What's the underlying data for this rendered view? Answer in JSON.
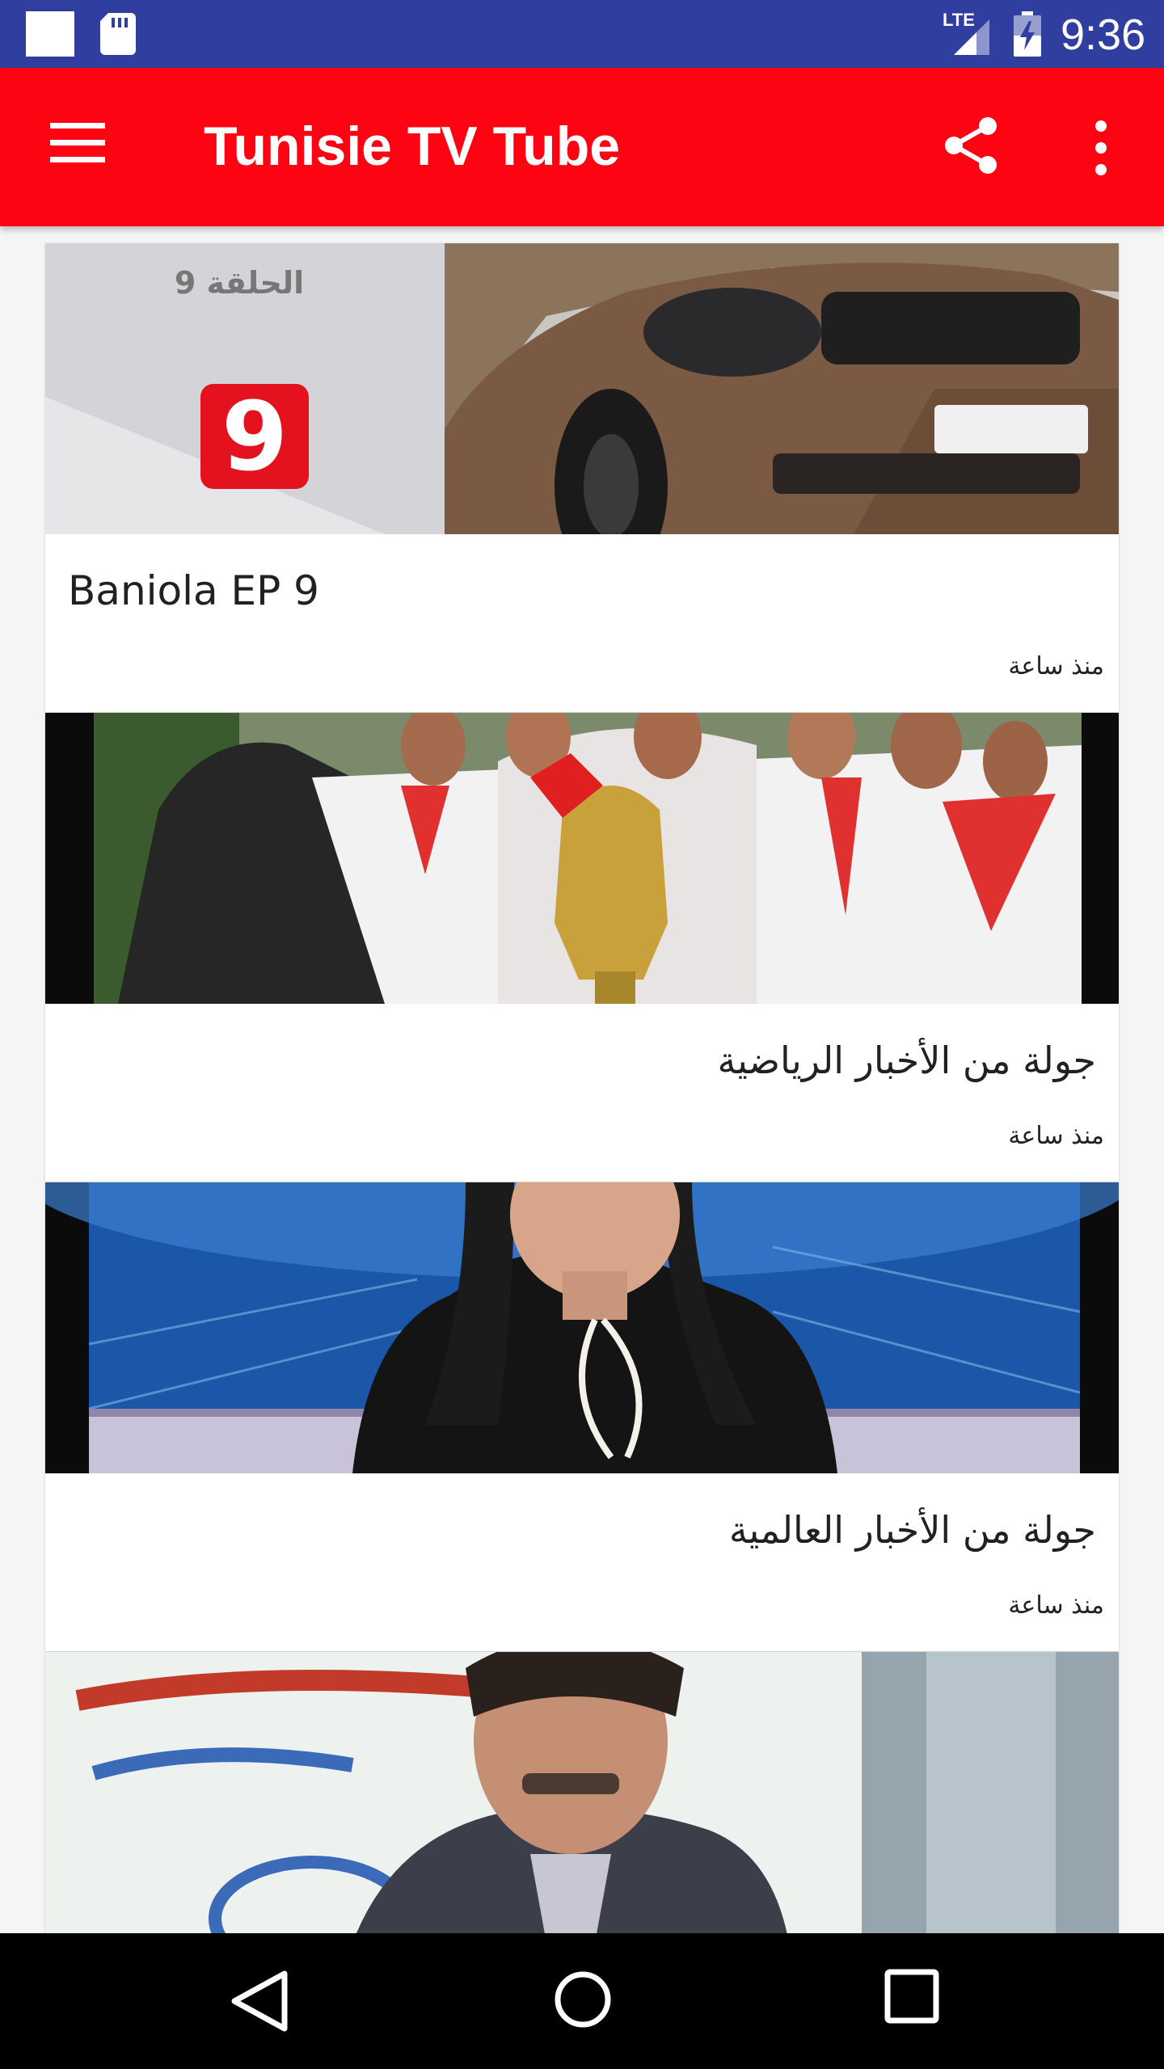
{
  "status_bar": {
    "network_label": "LTE",
    "time": "9:36",
    "icons": [
      "notification-square-icon",
      "sd-card-icon",
      "lte-signal-icon",
      "battery-charging-icon"
    ]
  },
  "app_bar": {
    "title": "Tunisie TV Tube",
    "background_color": "#fe0311",
    "icons": [
      "menu-icon",
      "share-icon",
      "more-vert-icon"
    ]
  },
  "videos": [
    {
      "title": "Baniola EP 9",
      "time": "منذ ساعة",
      "thumb_text": "الحلقة 9",
      "thumb_logo": "9"
    },
    {
      "title": "جولة من الأخبار الرياضية",
      "time": "منذ ساعة"
    },
    {
      "title": "جولة من الأخبار العالمية",
      "time": "منذ ساعة"
    },
    {
      "title": "",
      "time": ""
    }
  ],
  "nav_bar": {
    "icons": [
      "back-icon",
      "home-icon",
      "recents-icon"
    ]
  }
}
